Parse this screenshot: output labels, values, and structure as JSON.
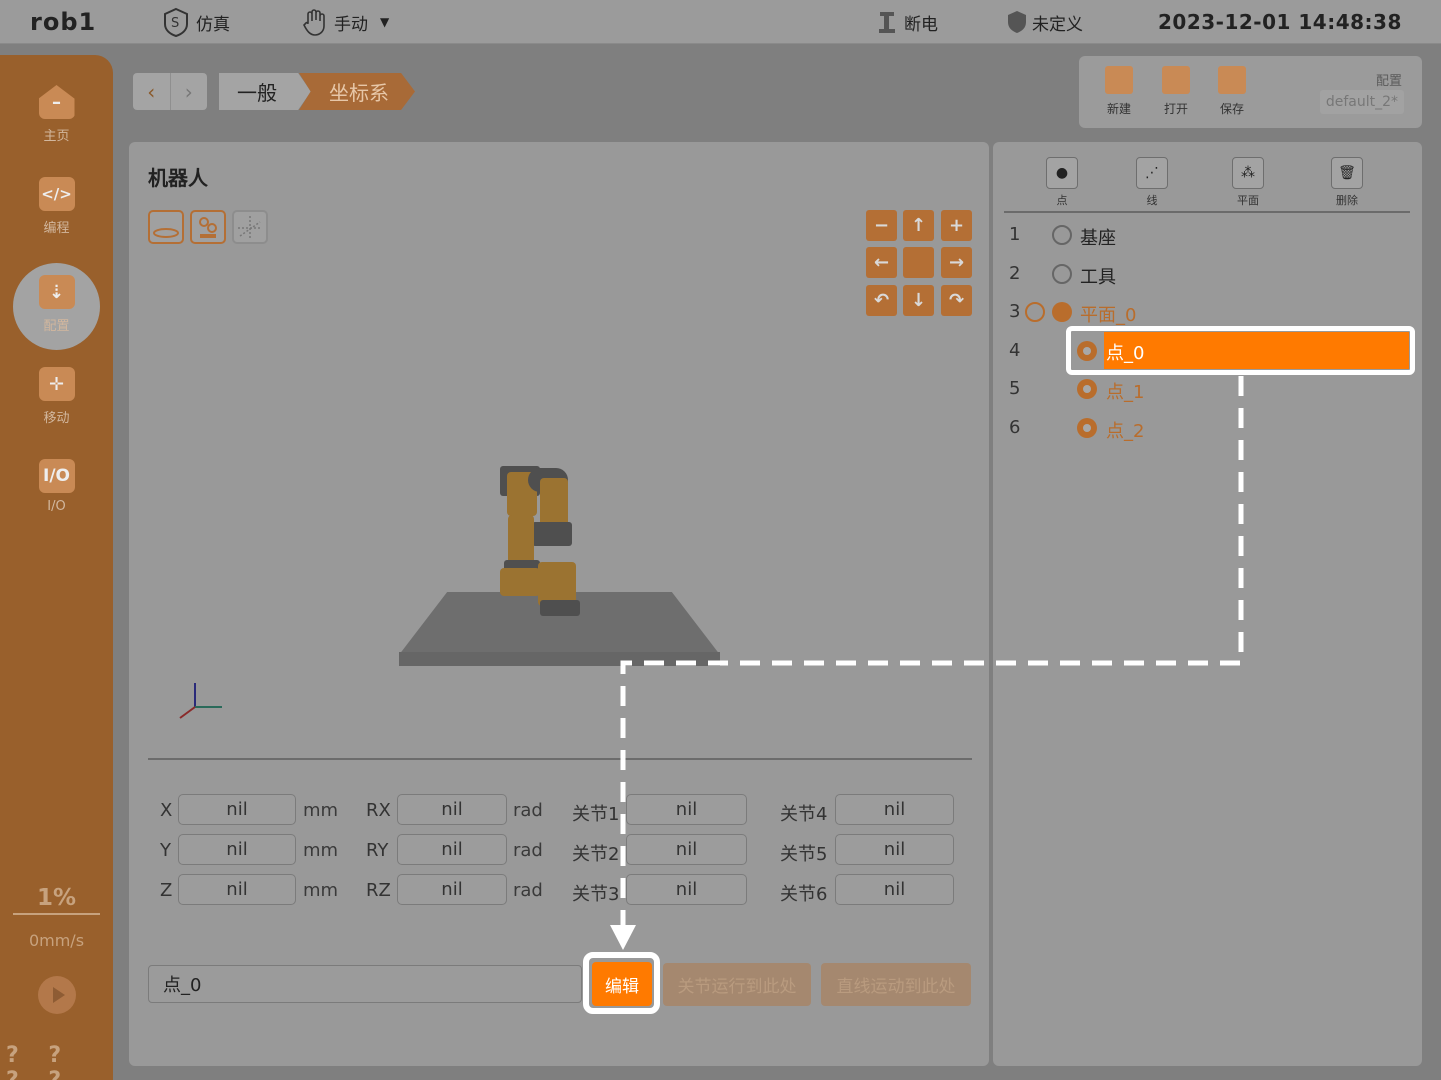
{
  "topbar": {
    "app_title": "rob1",
    "sim_label": "仿真",
    "mode_label": "手动",
    "power_label": "断电",
    "undefined_label": "未定义",
    "datetime": "2023-12-01 14:48:38"
  },
  "sidebar": {
    "items": [
      {
        "label": "主页",
        "icon": "home-icon"
      },
      {
        "label": "编程",
        "icon": "code-icon"
      },
      {
        "label": "配置",
        "icon": "config-icon"
      },
      {
        "label": "移动",
        "icon": "move-icon"
      },
      {
        "label": "I/O",
        "icon": "io-icon"
      }
    ],
    "io_icon_text": "I/O",
    "speed_percent": "1%",
    "speed_value": "0mm/s",
    "help_marks": "? ? ? ?"
  },
  "breadcrumb": [
    "一般",
    "坐标系"
  ],
  "file_toolbar": {
    "new_label": "新建",
    "open_label": "打开",
    "save_label": "保存",
    "config_label": "配置",
    "config_name": "default_2*"
  },
  "robot_panel": {
    "title": "机器人"
  },
  "fields": {
    "cartesian": [
      {
        "axis": "X",
        "value": "nil",
        "unit": "mm"
      },
      {
        "axis": "Y",
        "value": "nil",
        "unit": "mm"
      },
      {
        "axis": "Z",
        "value": "nil",
        "unit": "mm"
      }
    ],
    "rotation": [
      {
        "axis": "RX",
        "value": "nil",
        "unit": "rad"
      },
      {
        "axis": "RY",
        "value": "nil",
        "unit": "rad"
      },
      {
        "axis": "RZ",
        "value": "nil",
        "unit": "rad"
      }
    ],
    "joints_a": [
      {
        "label": "关节1",
        "value": "nil"
      },
      {
        "label": "关节2",
        "value": "nil"
      },
      {
        "label": "关节3",
        "value": "nil"
      }
    ],
    "joints_b": [
      {
        "label": "关节4",
        "value": "nil"
      },
      {
        "label": "关节5",
        "value": "nil"
      },
      {
        "label": "关节6",
        "value": "nil"
      }
    ]
  },
  "action_bar": {
    "name_value": "点_0",
    "edit_label": "编辑",
    "joint_move_label": "关节运行到此处",
    "linear_move_label": "直线运动到此处"
  },
  "tree_toolbar": {
    "point_label": "点",
    "line_label": "线",
    "plane_label": "平面",
    "delete_label": "删除"
  },
  "tree": [
    {
      "num": "1",
      "label": "基座"
    },
    {
      "num": "2",
      "label": "工具"
    },
    {
      "num": "3",
      "label": "平面_0"
    },
    {
      "num": "4",
      "label": "点_0"
    },
    {
      "num": "5",
      "label": "点_1"
    },
    {
      "num": "6",
      "label": "点_2"
    }
  ],
  "colors": {
    "accent": "#ff7a00",
    "highlight_outline": "#ffffff"
  }
}
